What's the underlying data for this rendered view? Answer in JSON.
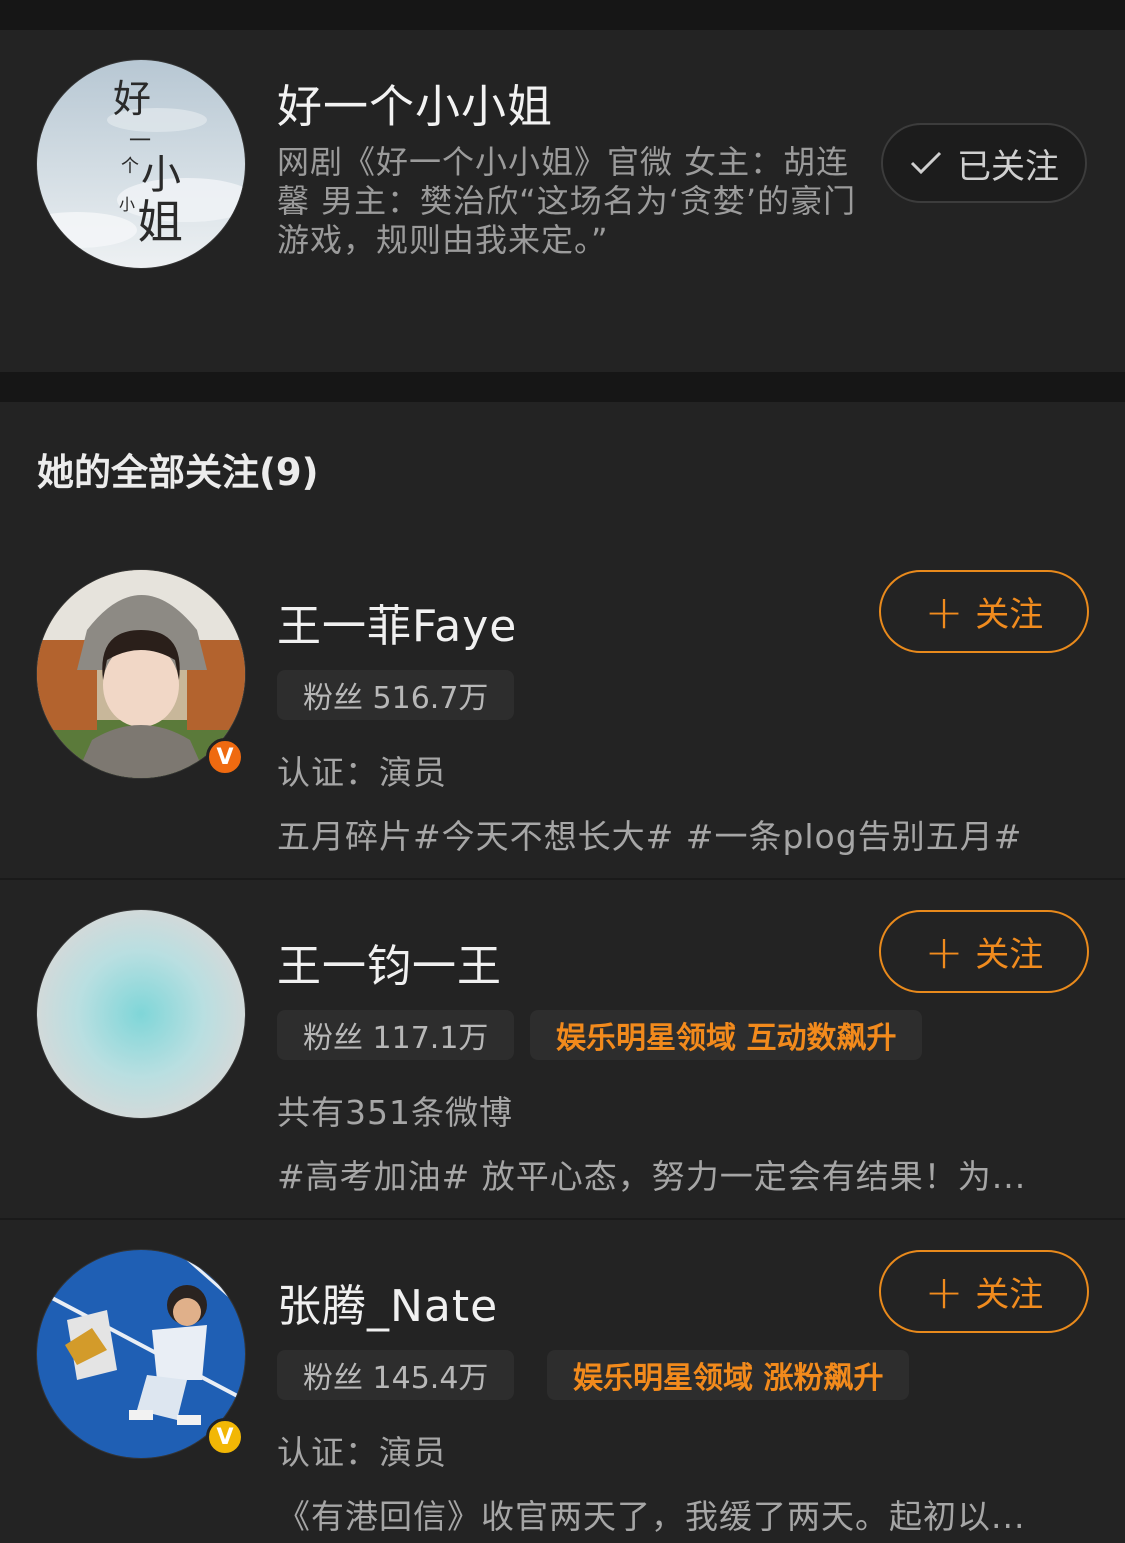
{
  "profile": {
    "name": "好一个小小姐",
    "bio": "网剧《好一个小小姐》官微 女主：胡连馨 男主：樊治欣“这场名为‘贪婪’的豪门游戏，规则由我来定。”",
    "follow_status": "已关注",
    "avatar_text": [
      "好",
      "一",
      "个",
      "小",
      "小",
      "姐"
    ]
  },
  "section": {
    "title": "她的全部关注(9)"
  },
  "users": [
    {
      "name": "王一菲Faye",
      "fans": "粉丝 516.7万",
      "hot_tag": "",
      "meta": "认证：演员",
      "desc": "五月碎片#今天不想长大# #一条plog告别五月#",
      "follow_label": "关注",
      "badge": "V",
      "badge_color": "#ef6a10"
    },
    {
      "name": "王一钧一王",
      "fans": "粉丝 117.1万",
      "hot_tag": "娱乐明星领域 互动数飙升",
      "meta": "共有351条微博",
      "desc": "#高考加油# 放平心态，努力一定会有结果！为...",
      "follow_label": "关注",
      "badge": "",
      "badge_color": ""
    },
    {
      "name": "张腾_Nate",
      "fans": "粉丝 145.4万",
      "hot_tag": "娱乐明星领域 涨粉飙升",
      "meta": "认证：演员",
      "desc": "《有港回信》收官两天了，我缓了两天。起初以...",
      "follow_label": "关注",
      "badge": "V",
      "badge_color": "#f2b705"
    }
  ],
  "colors": {
    "accent": "#f08b1e",
    "background": "#161616",
    "card": "#232323"
  }
}
